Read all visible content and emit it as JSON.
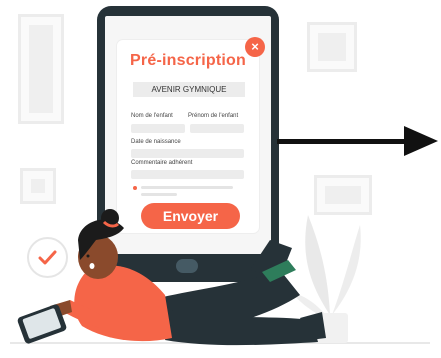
{
  "form": {
    "title": "Pré-inscription",
    "close_glyph": "×",
    "club_name": "AVENIR GYMNIQUE",
    "fields": {
      "lastname_label": "Nom de l'enfant",
      "firstname_label": "Prénom de l'enfant",
      "birthdate_label": "Date de naissance",
      "comment_label": "Commentaire adhérent"
    },
    "submit_label": "Envoyer"
  },
  "colors": {
    "accent": "#f56548",
    "tablet": "#263238",
    "field": "#ececec"
  },
  "icons": [
    "close-icon",
    "check-icon",
    "arrow-right-icon"
  ]
}
